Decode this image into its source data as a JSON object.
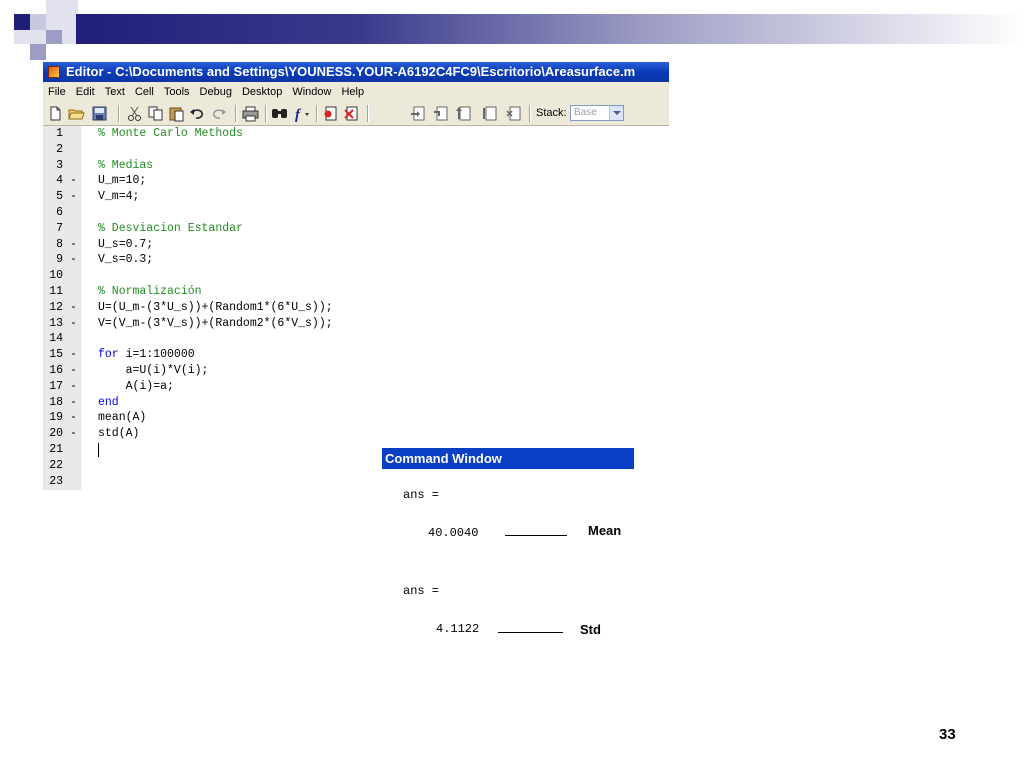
{
  "editor": {
    "title": "Editor - C:\\Documents and Settings\\YOUNESS.YOUR-A6192C4FC9\\Escritorio\\Areasurface.m",
    "menu": [
      "File",
      "Edit",
      "Text",
      "Cell",
      "Tools",
      "Debug",
      "Desktop",
      "Window",
      "Help"
    ],
    "toolbar_icons": [
      "new-file-icon",
      "open-folder-icon",
      "save-icon",
      "cut-icon",
      "copy-icon",
      "paste-icon",
      "undo-icon",
      "redo-icon",
      "print-icon",
      "find-icon",
      "function-icon",
      "set-breakpoint-icon",
      "clear-breakpoints-icon",
      "step-icon",
      "step-in-icon",
      "step-out-icon",
      "continue-icon",
      "exit-debug-icon"
    ],
    "stack_label": "Stack:",
    "stack_value": "Base",
    "lines": [
      {
        "n": "1",
        "dash": "",
        "type": "comment",
        "text": "% Monte Carlo Methods"
      },
      {
        "n": "2",
        "dash": "",
        "type": "plain",
        "text": ""
      },
      {
        "n": "3",
        "dash": "",
        "type": "comment",
        "text": "% Medias"
      },
      {
        "n": "4",
        "dash": "-",
        "type": "plain",
        "text": "U_m=10;"
      },
      {
        "n": "5",
        "dash": "-",
        "type": "plain",
        "text": "V_m=4;"
      },
      {
        "n": "6",
        "dash": "",
        "type": "plain",
        "text": ""
      },
      {
        "n": "7",
        "dash": "",
        "type": "comment",
        "text": "% Desviacion Estandar"
      },
      {
        "n": "8",
        "dash": "-",
        "type": "plain",
        "text": "U_s=0.7;"
      },
      {
        "n": "9",
        "dash": "-",
        "type": "plain",
        "text": "V_s=0.3;"
      },
      {
        "n": "10",
        "dash": "",
        "type": "plain",
        "text": ""
      },
      {
        "n": "11",
        "dash": "",
        "type": "comment",
        "text": "% Normalización"
      },
      {
        "n": "12",
        "dash": "-",
        "type": "plain",
        "text": "U=(U_m-(3*U_s))+(Random1*(6*U_s));"
      },
      {
        "n": "13",
        "dash": "-",
        "type": "plain",
        "text": "V=(V_m-(3*V_s))+(Random2*(6*V_s));"
      },
      {
        "n": "14",
        "dash": "",
        "type": "plain",
        "text": ""
      },
      {
        "n": "15",
        "dash": "-",
        "type": "keyword",
        "kw": "for",
        "text": " i=1:100000"
      },
      {
        "n": "16",
        "dash": "-",
        "type": "plain",
        "text": "    a=U(i)*V(i);"
      },
      {
        "n": "17",
        "dash": "-",
        "type": "plain",
        "text": "    A(i)=a;"
      },
      {
        "n": "18",
        "dash": "-",
        "type": "keyword",
        "kw": "end",
        "text": ""
      },
      {
        "n": "19",
        "dash": "-",
        "type": "plain",
        "text": "mean(A)"
      },
      {
        "n": "20",
        "dash": "-",
        "type": "plain",
        "text": "std(A)"
      },
      {
        "n": "21",
        "dash": "",
        "type": "plain",
        "text": ""
      },
      {
        "n": "22",
        "dash": "",
        "type": "plain",
        "text": ""
      },
      {
        "n": "23",
        "dash": "",
        "type": "plain",
        "text": ""
      }
    ]
  },
  "command_window": {
    "title": "Command Window",
    "ans1_label": "ans =",
    "ans1_value": "40.0040",
    "ans1_annotation": "Mean",
    "ans2_label": "ans =",
    "ans2_value": "4.1122",
    "ans2_annotation": "Std"
  },
  "slide": {
    "page_number": "33"
  },
  "colors": {
    "title_bar": "#0b3fc3",
    "comment": "#228b22",
    "keyword": "#0000ff",
    "deco_dark": "#1f1f7a",
    "deco_light": "#9c9cc4"
  }
}
